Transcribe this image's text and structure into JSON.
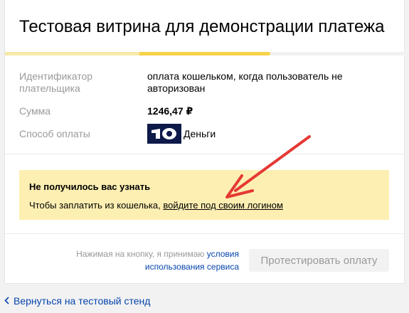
{
  "header": {
    "title": "Тестовая витрина для демонстрации платежа"
  },
  "progress": {
    "completed_steps": 2,
    "total_steps": 3
  },
  "details": {
    "payer_id_label": "Идентификатор плательщика",
    "payer_id_value": "оплата кошельком, когда пользователь не авторизован",
    "amount_label": "Сумма",
    "amount_value": "1246,47 ₽",
    "method_label": "Способ оплаты",
    "method_value": "Деньги"
  },
  "notice": {
    "title": "Не получилось вас узнать",
    "text_prefix": "Чтобы заплатить из кошелька, ",
    "link_text": "войдите под своим логином"
  },
  "footer": {
    "terms_prefix": "Нажимая на кнопку, я принимаю ",
    "terms_link": "условия использования сервиса",
    "button_label": "Протестировать оплату"
  },
  "back_link": {
    "label": "Вернуться на тестовый стенд"
  },
  "colors": {
    "progress_done": "#f7e9a8",
    "progress_active": "#f6d24a",
    "notice_bg": "#fdefb2",
    "link": "#0645ad",
    "arrow": "#e53935"
  },
  "icons": {
    "payment_logo": "yandex-money-logo",
    "back": "chevron-left-icon"
  }
}
